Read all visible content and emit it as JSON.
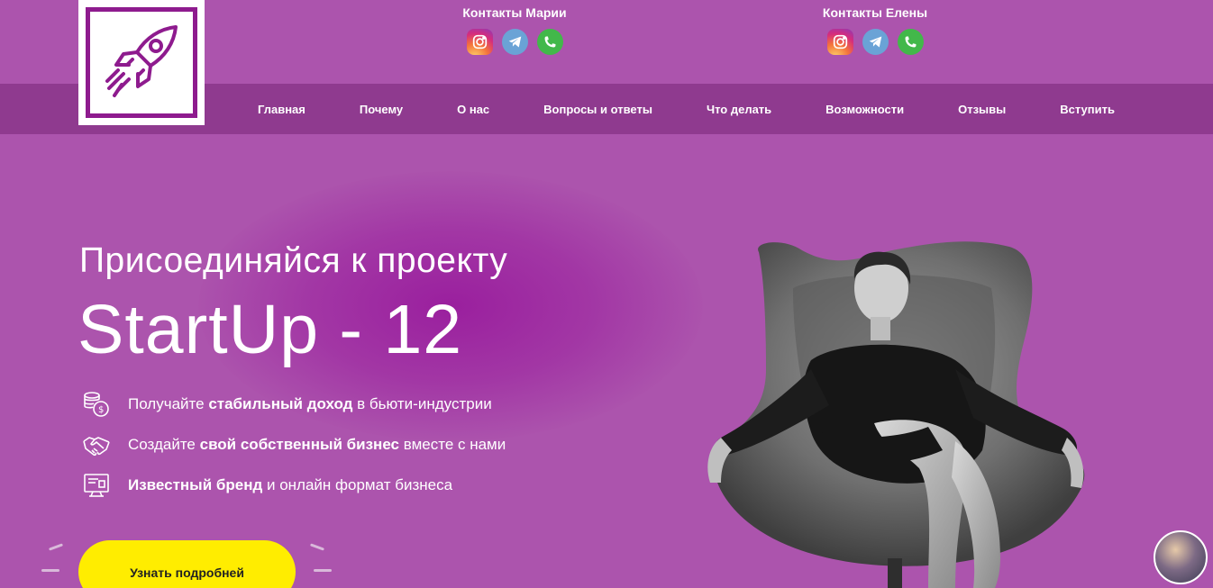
{
  "header": {
    "contacts": [
      {
        "title": "Контакты Марии",
        "socials": [
          "instagram-icon",
          "telegram-icon",
          "whatsapp-icon"
        ]
      },
      {
        "title": "Контакты Елены",
        "socials": [
          "instagram-icon",
          "telegram-icon",
          "whatsapp-icon"
        ]
      }
    ],
    "nav": [
      "Главная",
      "Почему",
      "О нас",
      "Вопросы и ответы",
      "Что делать",
      "Возможности",
      "Отзывы",
      "Вступить"
    ]
  },
  "hero": {
    "subtitle": "Присоединяйся к проекту",
    "title": "StartUp - 12",
    "features": [
      {
        "icon": "coins-icon",
        "before": "Получайте ",
        "bold": "стабильный доход",
        "after": " в бьюти-индустрии"
      },
      {
        "icon": "handshake-icon",
        "before": "Создайте ",
        "bold": "свой собственный бизнес",
        "after": " вместе с нами"
      },
      {
        "icon": "monitor-icon",
        "before": "",
        "bold": "Известный бренд",
        "after": " и онлайн формат бизнеса"
      }
    ],
    "cta_label": "Узнать подробней"
  },
  "colors": {
    "background": "#ac54ad",
    "navbar": "#8f3a8f",
    "brand": "#8e1b8e",
    "cta": "#ffed00"
  }
}
